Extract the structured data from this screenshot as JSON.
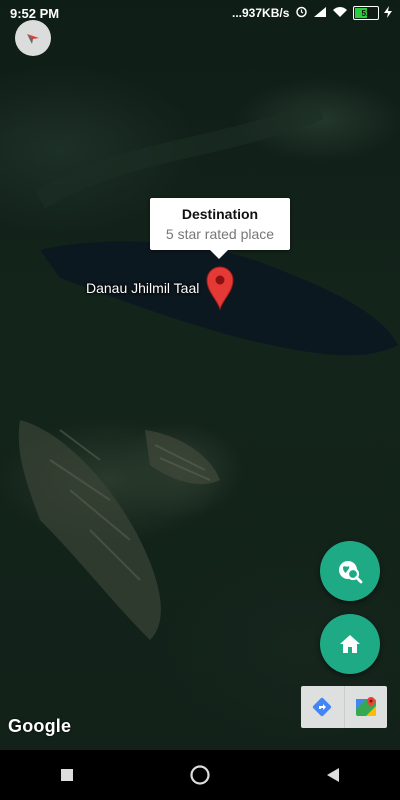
{
  "status": {
    "time": "9:52 PM",
    "speed": "...937KB/s",
    "battery": "51",
    "icons": [
      "alarm-icon",
      "signal-icon",
      "wifi-icon",
      "battery-icon",
      "charging-icon"
    ]
  },
  "map": {
    "place_label": "Danau Jhilmil Taal",
    "callout": {
      "title": "Destination",
      "subtitle": "5 star rated place"
    },
    "attribution": "Google"
  },
  "buttons": {
    "search_place_icon": "travel-explore-icon",
    "home_icon": "home-icon",
    "directions_icon": "directions-icon",
    "maps_app_icon": "google-maps-icon"
  },
  "nav": {
    "icons": [
      "recent-apps-icon",
      "home-circle-icon",
      "back-icon"
    ]
  },
  "colors": {
    "fab": "#1faa86",
    "pin": "#e53935",
    "navbar": "#000000"
  }
}
